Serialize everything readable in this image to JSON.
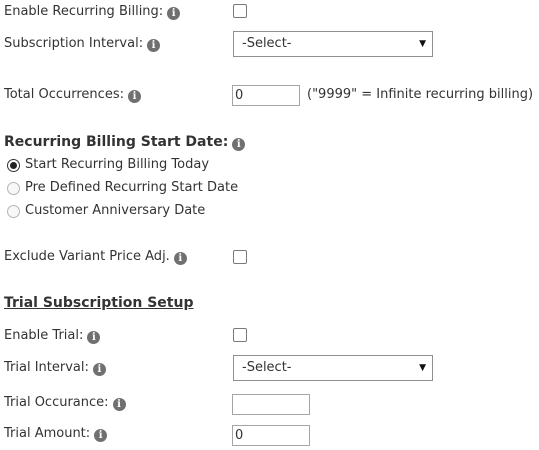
{
  "recurring": {
    "enable_label": "Enable Recurring Billing:",
    "interval_label": "Subscription Interval:",
    "interval_value": "-Select-",
    "occurrences_label": "Total Occurrences:",
    "occurrences_value": "0",
    "occurrences_hint": "(\"9999\" = Infinite recurring billing)"
  },
  "start_date": {
    "heading": "Recurring Billing Start Date:",
    "options": [
      {
        "label": "Start Recurring Billing Today",
        "selected": true
      },
      {
        "label": "Pre Defined Recurring Start Date",
        "selected": false
      },
      {
        "label": "Customer Anniversary Date",
        "selected": false
      }
    ]
  },
  "exclude": {
    "label": "Exclude Variant Price Adj."
  },
  "trial": {
    "heading": "Trial Subscription Setup",
    "enable_label": "Enable Trial:",
    "interval_label": "Trial Interval:",
    "interval_value": "-Select-",
    "occurance_label": "Trial Occurance:",
    "occurance_value": "",
    "amount_label": "Trial Amount:",
    "amount_value": "0"
  },
  "icons": {
    "info": "info-icon",
    "dropdown": "caret-down-icon"
  },
  "info_glyph": "i",
  "caret_glyph": "▼"
}
